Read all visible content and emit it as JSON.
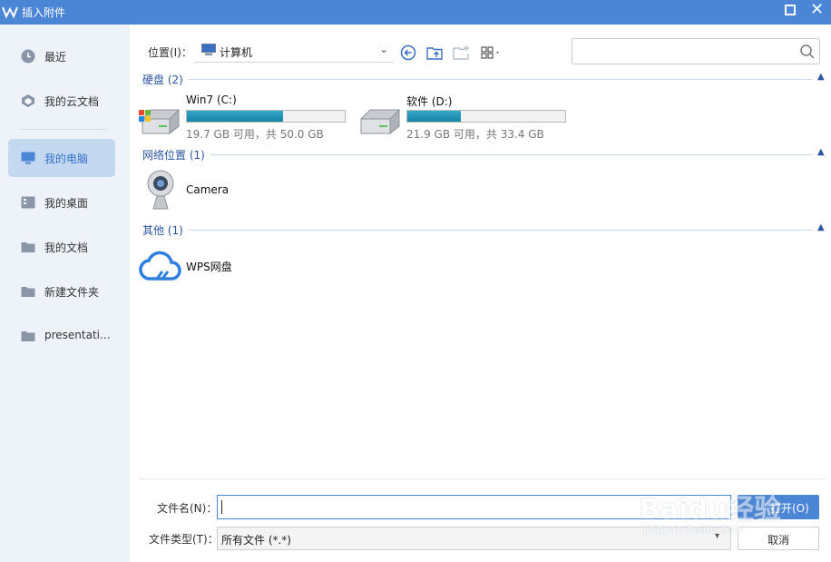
{
  "window": {
    "title": "插入附件"
  },
  "colors": {
    "accent": "#4b86d6",
    "sidebar_bg": "#eef2f9",
    "active_item_bg": "#c5d8f2",
    "group_title": "#2a55a0",
    "drive_fill": "#1e90b4"
  },
  "sidebar": {
    "items": [
      {
        "label": "最近",
        "icon": "clock-icon"
      },
      {
        "label": "我的云文档",
        "icon": "cloud-doc-icon"
      },
      {
        "label": "我的电脑",
        "icon": "computer-icon",
        "active": true
      },
      {
        "label": "我的桌面",
        "icon": "desktop-icon"
      },
      {
        "label": "我的文档",
        "icon": "folder-icon"
      },
      {
        "label": "新建文件夹",
        "icon": "folder-icon"
      },
      {
        "label": "presentati...",
        "icon": "folder-icon"
      }
    ]
  },
  "toolbar": {
    "location_label": "位置(I)：",
    "location_value": "计算机",
    "icons": [
      "back-icon",
      "up-folder-icon",
      "new-folder-icon",
      "view-mode-icon"
    ],
    "search_placeholder": ""
  },
  "groups": {
    "drives": {
      "title": "硬盘 (2)"
    },
    "network": {
      "title": "网络位置 (1)"
    },
    "other": {
      "title": "其他 (1)"
    }
  },
  "drives": [
    {
      "name": "Win7 (C:)",
      "info": "19.7 GB 可用，共 50.0 GB",
      "used_fraction": 0.61
    },
    {
      "name": "软件 (D:)",
      "info": "21.9 GB 可用，共 33.4 GB",
      "used_fraction": 0.34
    }
  ],
  "network_items": [
    {
      "name": "Camera"
    }
  ],
  "other_items": [
    {
      "name": "WPS网盘"
    }
  ],
  "footer": {
    "filename_label": "文件名(N)：",
    "filename_value": "",
    "filetype_label": "文件类型(T)：",
    "filetype_value": "所有文件 (*.*)",
    "open_label": "打开(O)",
    "cancel_label": "取消"
  },
  "watermark": {
    "text": "Baidu经验",
    "url": "jingyan.baidu.com"
  }
}
